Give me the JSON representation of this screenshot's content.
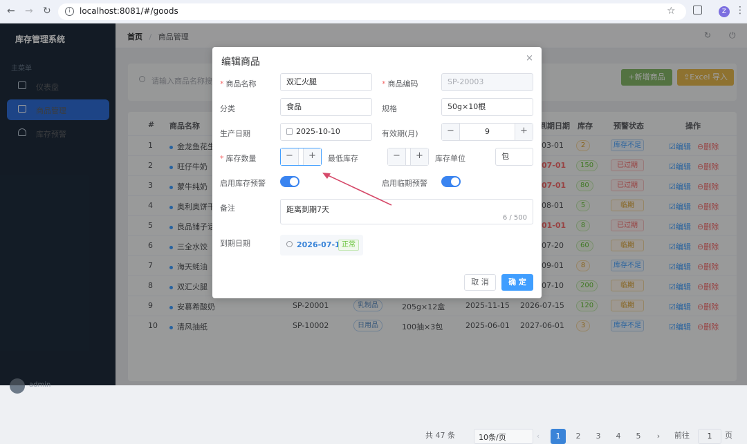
{
  "browser": {
    "url": "localhost:8081/#/goods",
    "profile_initial": "Z"
  },
  "sidebar": {
    "brand": "库存管理系统",
    "group_label": "主菜单",
    "items": [
      {
        "label": "仪表盘"
      },
      {
        "label": "商品管理"
      },
      {
        "label": "库存预警"
      }
    ],
    "user_name": "admin"
  },
  "header": {
    "breadcrumb_home": "首页",
    "breadcrumb_sep": "/",
    "breadcrumb_current": "商品管理"
  },
  "toolbar": {
    "search_placeholder": "请输入商品名称搜索",
    "add_label": "+新增商品",
    "import_label": "⇪Excel 导入"
  },
  "table": {
    "headers": [
      "#",
      "商品名称",
      "到期日期",
      "库存",
      "预警状态",
      "操作"
    ],
    "edit_label": "☑编辑",
    "delete_label": "⊖删除",
    "rows": [
      {
        "idx": "1",
        "name": "金龙鱼花生",
        "expiry": "03-01",
        "stock": "2",
        "status": "库存不足"
      },
      {
        "idx": "2",
        "name": "旺仔牛奶",
        "expiry": "07-01",
        "stock": "150",
        "status": "已过期"
      },
      {
        "idx": "3",
        "name": "蒙牛纯奶",
        "expiry": "07-01",
        "stock": "80",
        "status": "已过期"
      },
      {
        "idx": "4",
        "name": "奥利奥饼干",
        "expiry": "08-01",
        "stock": "5",
        "status": "临期"
      },
      {
        "idx": "5",
        "name": "良品铺子话",
        "expiry": "01-01",
        "stock": "8",
        "status": "已过期"
      },
      {
        "idx": "6",
        "name": "三全水饺",
        "expiry": "07-20",
        "stock": "60",
        "status": "临期"
      },
      {
        "idx": "7",
        "name": "海天蚝油",
        "expiry": "09-01",
        "stock": "8",
        "status": "库存不足"
      },
      {
        "idx": "8",
        "name": "双汇火腿",
        "expiry": "07-10",
        "stock": "200",
        "status": "临期"
      },
      {
        "idx": "9",
        "name": "安慕希酸奶",
        "code": "SP-20001",
        "category": "乳制品",
        "spec": "205g×12盒",
        "prod": "2025-11-15",
        "expiry": "2026-07-15",
        "stock": "120",
        "status": "临期"
      },
      {
        "idx": "10",
        "name": "清风抽纸",
        "code": "SP-10002",
        "category": "日用品",
        "spec": "100抽×3包",
        "prod": "2025-06-01",
        "expiry": "2027-06-01",
        "stock": "3",
        "status": "库存不足"
      }
    ]
  },
  "pagination": {
    "total": "共 47 条",
    "page_size": "10条/页",
    "pages": [
      "1",
      "2",
      "3",
      "4",
      "5"
    ],
    "jump_label": "前往",
    "jump_value": "1",
    "jump_suffix": "页"
  },
  "dialog": {
    "title": "编辑商品",
    "close": "×",
    "name_label": "商品名称",
    "name_value": "双汇火腿",
    "code_label": "商品编码",
    "code_value": "SP-20003",
    "category_label": "分类",
    "category_value": "食品",
    "spec_label": "规格",
    "spec_value": "50g×10根",
    "prod_label": "生产日期",
    "prod_value": "2025-10-10",
    "shelf_label": "有效期(月)",
    "shelf_value": "9",
    "qty_label": "库存数量",
    "qty_value": "",
    "min_label": "最低库存",
    "min_value": "",
    "unit_label": "库存单位",
    "unit_value": "包",
    "stock_alert_label": "启用库存预警",
    "expiry_alert_label": "启用临期预警",
    "remark_label": "备注",
    "remark_value": "距离到期7天",
    "remark_count": "6 / 500",
    "expiry_label": "到期日期",
    "expiry_value": "2026-07-10",
    "expiry_status": "正常",
    "cancel": "取 消",
    "confirm": "确 定",
    "minus": "−",
    "plus": "+"
  },
  "colors": {
    "primary": "#409eff",
    "sidebar_bg": "#1f2d3d",
    "sidebar_active": "#2f6fd8",
    "annotation_arrow": "#d64a6a"
  }
}
